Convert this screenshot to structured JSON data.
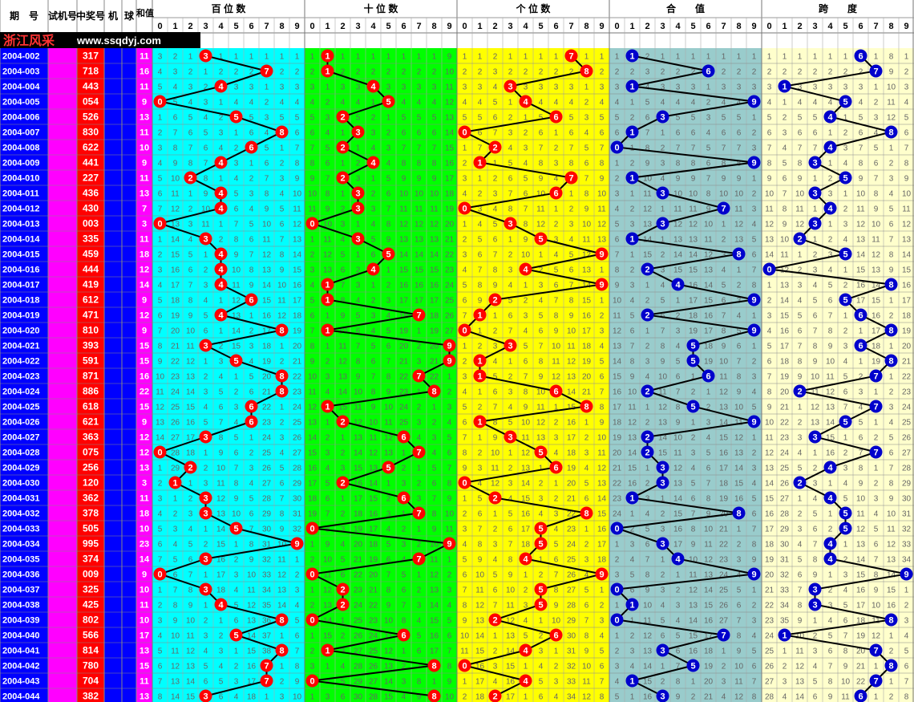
{
  "header": {
    "col_period": "期　号",
    "col_test": "试机号",
    "col_win": "中奖号",
    "col_machine": "机",
    "col_ball": "球",
    "col_sum": "和值",
    "sections": [
      {
        "key": "bai",
        "label": "百 位 数",
        "color": "#00ffff"
      },
      {
        "key": "shi",
        "label": "十 位 数",
        "color": "#00ff00"
      },
      {
        "key": "ge",
        "label": "个 位 数",
        "color": "#ffff00"
      },
      {
        "key": "he",
        "label": "合　　值",
        "color": "#99cccc"
      },
      {
        "key": "kua",
        "label": "跨　　度",
        "color": "#ffffcc"
      }
    ],
    "digits": [
      "0",
      "1",
      "2",
      "3",
      "4",
      "5",
      "6",
      "7",
      "8",
      "9"
    ],
    "brand": "浙江风采",
    "url": "www.ssqdyj.com"
  },
  "colors": {
    "period_bg": "#0000ff",
    "test_bg": "#ff00ff",
    "win_bg": "#ff0000",
    "machine_bg": "#0000ff",
    "sum_bg": "#ff00ff",
    "ball_red": "#ff0000",
    "ball_blue": "#0000cc"
  },
  "chart_data": {
    "type": "table",
    "periods": [
      "2004-002",
      "2004-003",
      "2004-004",
      "2004-005",
      "2004-006",
      "2004-007",
      "2004-008",
      "2004-009",
      "2004-010",
      "2004-011",
      "2004-012",
      "2004-013",
      "2004-014",
      "2004-015",
      "2004-016",
      "2004-017",
      "2004-018",
      "2004-019",
      "2004-020",
      "2004-021",
      "2004-022",
      "2004-023",
      "2004-024",
      "2004-025",
      "2004-026",
      "2004-027",
      "2004-028",
      "2004-029",
      "2004-030",
      "2004-031",
      "2004-032",
      "2004-033",
      "2004-034",
      "2004-035",
      "2004-036",
      "2004-037",
      "2004-038",
      "2004-039",
      "2004-040",
      "2004-041",
      "2004-042",
      "2004-043",
      "2004-044"
    ],
    "winning": [
      "317",
      "718",
      "443",
      "054",
      "526",
      "830",
      "622",
      "441",
      "227",
      "436",
      "430",
      "003",
      "335",
      "459",
      "444",
      "419",
      "612",
      "471",
      "810",
      "393",
      "591",
      "871",
      "886",
      "618",
      "621",
      "363",
      "075",
      "256",
      "120",
      "362",
      "378",
      "505",
      "995",
      "374",
      "009",
      "325",
      "425",
      "802",
      "566",
      "814",
      "780",
      "704",
      "382"
    ],
    "sums": [
      11,
      16,
      11,
      9,
      13,
      11,
      10,
      9,
      11,
      13,
      7,
      3,
      11,
      18,
      12,
      14,
      9,
      12,
      9,
      15,
      15,
      16,
      22,
      15,
      9,
      12,
      12,
      13,
      3,
      11,
      18,
      10,
      23,
      14,
      9,
      10,
      11,
      10,
      17,
      13,
      15,
      11,
      13
    ],
    "first_row": {
      "bai": [
        3,
        2,
        1,
        0,
        1,
        1,
        1,
        1,
        1,
        1
      ],
      "shi": [
        1,
        1,
        1,
        1,
        1,
        1,
        1,
        1,
        1,
        9
      ],
      "ge": [
        1,
        1,
        2,
        1,
        1,
        1,
        1,
        1,
        1,
        1
      ],
      "he": [
        1,
        1,
        2,
        1,
        1,
        1,
        1,
        1,
        1,
        1
      ],
      "kua": [
        1,
        1,
        1,
        1,
        1,
        1,
        1,
        1,
        8,
        1
      ]
    }
  }
}
